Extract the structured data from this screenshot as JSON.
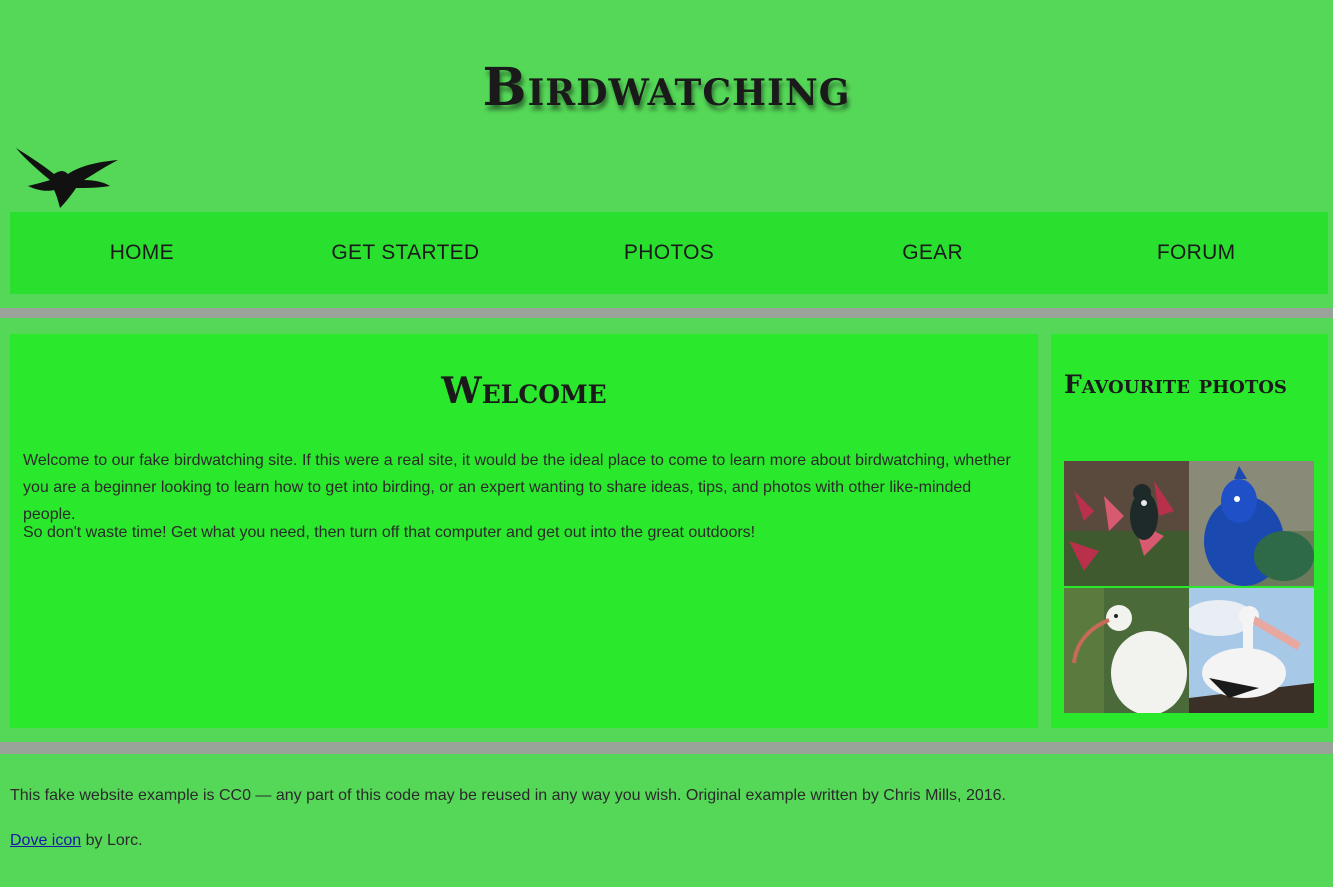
{
  "header": {
    "title": "Birdwatching",
    "logo_icon": "dove-icon"
  },
  "nav": {
    "items": [
      {
        "label": "HOME"
      },
      {
        "label": "GET STARTED"
      },
      {
        "label": "PHOTOS"
      },
      {
        "label": "GEAR"
      },
      {
        "label": "FORUM"
      }
    ]
  },
  "main": {
    "heading": "Welcome",
    "paragraphs": [
      "Welcome to our fake birdwatching site. If this were a real site, it would be the ideal place to come to learn more about birdwatching, whether you are a beginner looking to learn how to get into birding, or an expert wanting to share ideas, tips, and photos with other like-minded people.",
      "So don't waste time! Get what you need, then turn off that computer and get out into the great outdoors!"
    ]
  },
  "aside": {
    "heading": "Favourite photos"
  },
  "footer": {
    "license_text": "This fake website example is CC0 — any part of this code may be reused in any way you wish. Original example written by Chris Mills, 2016.",
    "credit_link": "Dove icon",
    "credit_suffix": " by Lorc."
  },
  "colors": {
    "page_bg": "#55d858",
    "panel_bg": "#2ae82c",
    "band": "#9aa39a"
  }
}
